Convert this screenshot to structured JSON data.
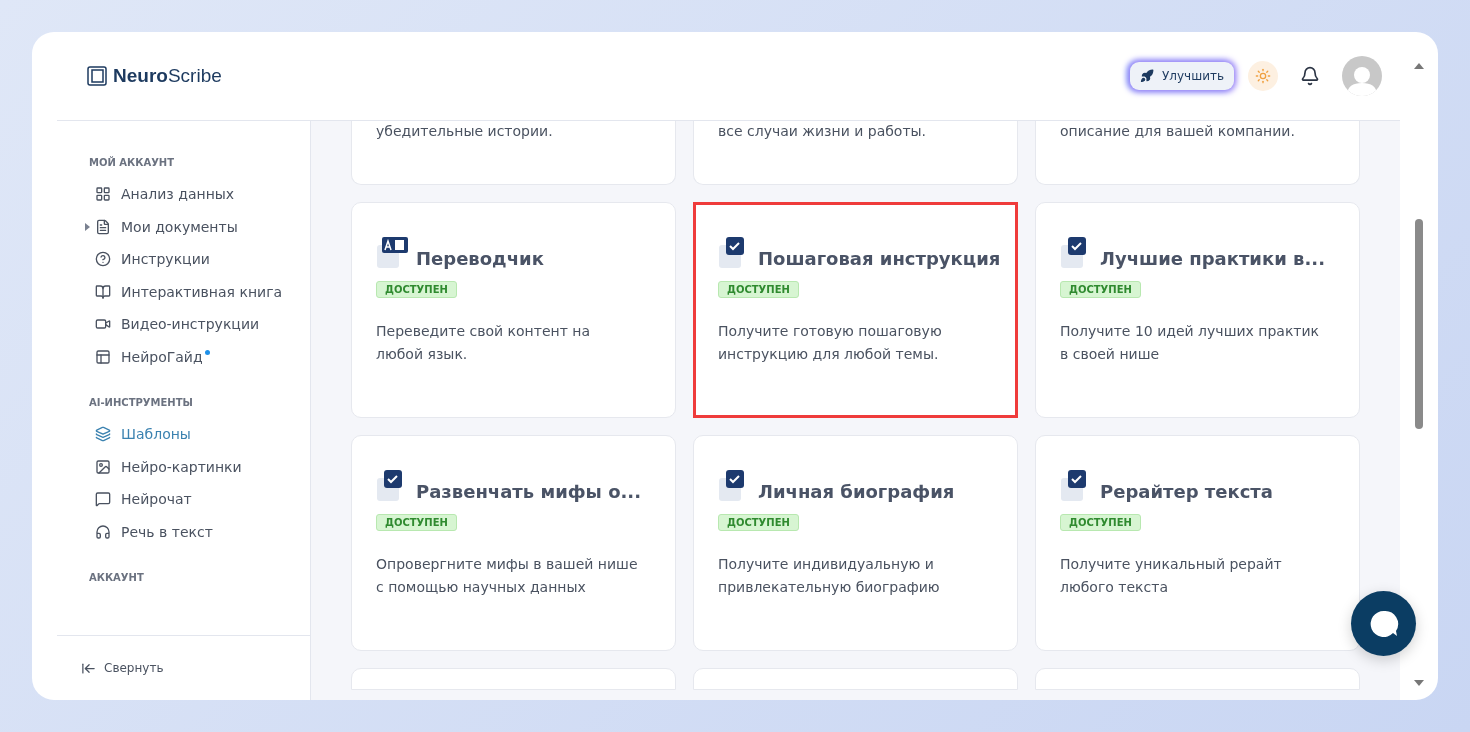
{
  "brand": {
    "bold": "Neuro",
    "rest": "Scribe"
  },
  "header": {
    "upgrade": "Улучшить"
  },
  "sidebar": {
    "sections": [
      {
        "title": "МОЙ АККАУНТ",
        "items": [
          {
            "label": "Анализ данных",
            "selected": false,
            "expandable": false,
            "dot": false
          },
          {
            "label": "Мои документы",
            "selected": false,
            "expandable": true,
            "dot": false
          },
          {
            "label": "Инструкции",
            "selected": false,
            "expandable": false,
            "dot": false
          },
          {
            "label": "Интерактивная книга",
            "selected": false,
            "expandable": false,
            "dot": false
          },
          {
            "label": "Видео-инструкции",
            "selected": false,
            "expandable": false,
            "dot": false
          },
          {
            "label": "НейроГайд",
            "selected": false,
            "expandable": false,
            "dot": true
          }
        ]
      },
      {
        "title": "AI-ИНСТРУМЕНТЫ",
        "items": [
          {
            "label": "Шаблоны",
            "selected": true,
            "expandable": false,
            "dot": false
          },
          {
            "label": "Нейро-картинки",
            "selected": false,
            "expandable": false,
            "dot": false
          },
          {
            "label": "Нейрочат",
            "selected": false,
            "expandable": false,
            "dot": false
          },
          {
            "label": "Речь в текст",
            "selected": false,
            "expandable": false,
            "dot": false
          }
        ]
      },
      {
        "title": "АККАУНТ"
      }
    ],
    "collapse": "Свернуть"
  },
  "partial_cards": [
    "убедительные истории.",
    "все случаи жизни и работы.",
    "описание для вашей компании."
  ],
  "cards": [
    {
      "title": "Переводчик",
      "badge": "ДОСТУПЕН",
      "description": "Переведите свой контент на любой язык.",
      "highlighted": false
    },
    {
      "title": "Пошаговая инструкция",
      "badge": "ДОСТУПЕН",
      "description": "Получите готовую пошаговую инструкцию для любой темы.",
      "highlighted": true
    },
    {
      "title": "Лучшие практики в...",
      "badge": "ДОСТУПЕН",
      "description": "Получите 10 идей лучших практик в своей нише",
      "highlighted": false
    },
    {
      "title": "Развенчать мифы о...",
      "badge": "ДОСТУПЕН",
      "description": "Опровергните мифы в вашей нише с помощью научных данных",
      "highlighted": false
    },
    {
      "title": "Личная биография",
      "badge": "ДОСТУПЕН",
      "description": "Получите индивидуальную и привлекательную биографию",
      "highlighted": false
    },
    {
      "title": "Рерайтер текста",
      "badge": "ДОСТУПЕН",
      "description": "Получите уникальный рерайт любого текста",
      "highlighted": false
    }
  ]
}
